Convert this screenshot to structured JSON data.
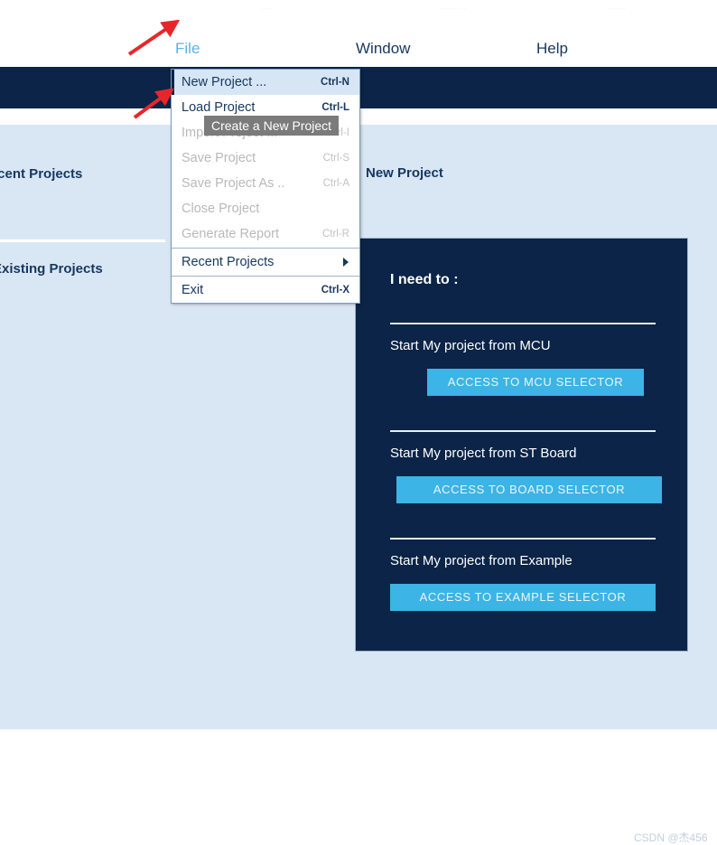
{
  "top_strip": {
    "fragment_1": "....",
    "fragment_2": "..........",
    "fragment_3": "......."
  },
  "menubar": {
    "items": [
      {
        "label": "File",
        "active": true
      },
      {
        "label": "Window",
        "active": false
      },
      {
        "label": "Help",
        "active": false
      }
    ]
  },
  "file_menu": {
    "items": [
      {
        "label": "New Project ...",
        "shortcut": "Ctrl-N",
        "disabled": false,
        "highlight": true,
        "submenu": false
      },
      {
        "label": "Load Project",
        "shortcut": "Ctrl-L",
        "disabled": false,
        "highlight": false,
        "submenu": false
      },
      {
        "label": "Import Project ...",
        "shortcut": "Ctrl-I",
        "disabled": true,
        "highlight": false,
        "submenu": false
      },
      {
        "label": "Save Project",
        "shortcut": "Ctrl-S",
        "disabled": true,
        "highlight": false,
        "submenu": false
      },
      {
        "label": "Save Project As ..",
        "shortcut": "Ctrl-A",
        "disabled": true,
        "highlight": false,
        "submenu": false
      },
      {
        "label": "Close Project",
        "shortcut": "",
        "disabled": true,
        "highlight": false,
        "submenu": false
      },
      {
        "label": "Generate Report",
        "shortcut": "Ctrl-R",
        "disabled": true,
        "highlight": false,
        "submenu": false
      },
      {
        "label": "Recent Projects",
        "shortcut": "",
        "disabled": false,
        "highlight": false,
        "submenu": true
      },
      {
        "label": "Exit",
        "shortcut": "Ctrl-X",
        "disabled": false,
        "highlight": false,
        "submenu": false
      }
    ]
  },
  "tooltip": {
    "text": "Create a New Project"
  },
  "left_panels": {
    "recent_heading": "Recent Projects",
    "existing_heading": "Existing Projects"
  },
  "main": {
    "new_project_heading": "New Project"
  },
  "card": {
    "title": "I need to :",
    "sections": [
      {
        "label": "Start My project from MCU",
        "button": "ACCESS TO MCU SELECTOR"
      },
      {
        "label": "Start My project from ST Board",
        "button": "ACCESS TO BOARD SELECTOR"
      },
      {
        "label": "Start My project from Example",
        "button": "ACCESS TO EXAMPLE SELECTOR"
      }
    ]
  },
  "annotations": {
    "arrow_1": "red-arrow-pointing-to-file-menu",
    "arrow_2": "red-arrow-pointing-to-new-project-item"
  },
  "watermark": {
    "text": "CSDN @杰456"
  },
  "colors": {
    "toolbar_navy": "#0b2447",
    "workspace_blue": "#d9e7f5",
    "accent_blue": "#3cb4e5",
    "menu_active": "#56b4e8",
    "tooltip_gray": "#7b7b7b",
    "annotation_red": "#e8262a"
  }
}
